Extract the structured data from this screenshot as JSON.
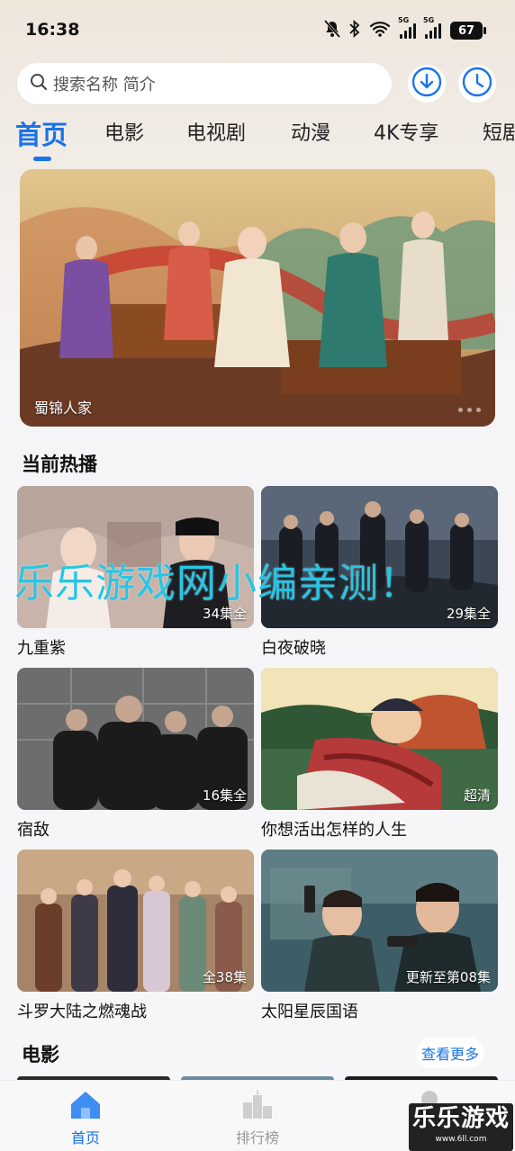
{
  "status_bar": {
    "time": "16:38",
    "network_tag_1": "5G",
    "network_tag_2": "5G",
    "battery": "67"
  },
  "search": {
    "placeholder": "搜索名称 简介",
    "icon": "search-icon"
  },
  "header_buttons": {
    "download_icon": "download-icon",
    "history_icon": "clock-icon"
  },
  "tabs": [
    {
      "label": "首页",
      "active": true
    },
    {
      "label": "电影",
      "active": false
    },
    {
      "label": "电视剧",
      "active": false
    },
    {
      "label": "动漫",
      "active": false
    },
    {
      "label": "4K专享",
      "active": false
    },
    {
      "label": "短剧",
      "active": false
    }
  ],
  "banner": {
    "caption": "蜀锦人家"
  },
  "hot_section": {
    "title": "当前热播",
    "items": [
      {
        "title": "九重紫",
        "badge": "34集全"
      },
      {
        "title": "白夜破晓",
        "badge": "29集全"
      },
      {
        "title": "宿敌",
        "badge": "16集全"
      },
      {
        "title": "你想活出怎样的人生",
        "badge": "超清"
      },
      {
        "title": "斗罗大陆之燃魂战",
        "badge": "全38集"
      },
      {
        "title": "太阳星辰国语",
        "badge": "更新至第08集"
      }
    ]
  },
  "movie_section": {
    "title": "电影",
    "more_label": "查看更多"
  },
  "bottom_nav": [
    {
      "label": "首页",
      "icon": "home-icon",
      "active": true
    },
    {
      "label": "排行榜",
      "icon": "ranking-icon",
      "active": false
    },
    {
      "label": "",
      "icon": "profile-icon",
      "active": false
    }
  ],
  "watermark": "乐乐游戏网小编亲测！",
  "logo": {
    "text": "乐乐游戏",
    "sub": "www.6ll.com"
  },
  "colors": {
    "accent": "#1a73e8",
    "watermark": "#26c6e6"
  }
}
